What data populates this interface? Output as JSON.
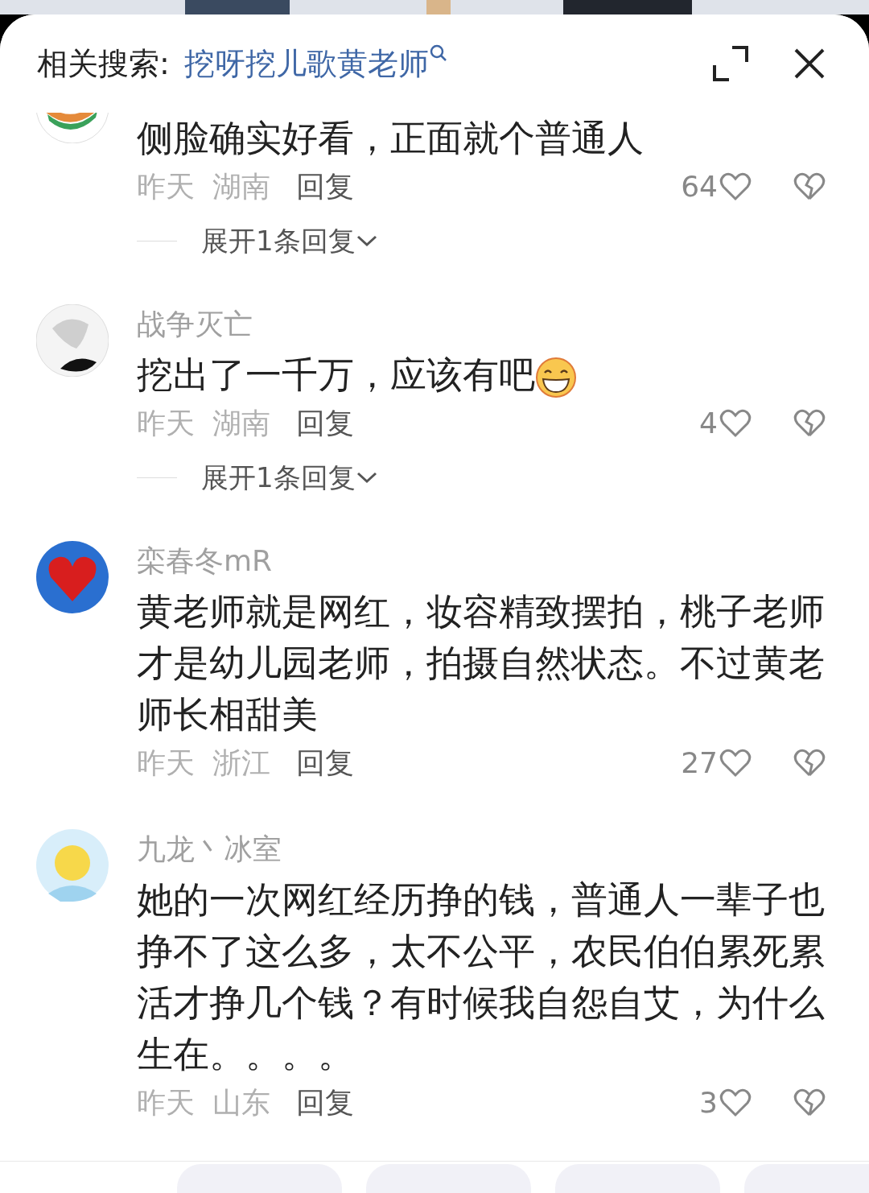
{
  "header": {
    "label": "相关搜索:",
    "query": "挖呀挖儿歌黄老师"
  },
  "comments": [
    {
      "text": "侧脸确实好看，正面就个普通人",
      "time": "昨天",
      "location": "湖南",
      "reply": "回复",
      "likes": "64",
      "expand": "展开1条回复"
    },
    {
      "name": "战争灭亡",
      "text": "挖出了一千万，应该有吧",
      "emoji": true,
      "time": "昨天",
      "location": "湖南",
      "reply": "回复",
      "likes": "4",
      "expand": "展开1条回复"
    },
    {
      "name": "栾春冬mR",
      "text": "黄老师就是网红，妆容精致摆拍，桃子老师才是幼儿园老师，拍摄自然状态。不过黄老师长相甜美",
      "time": "昨天",
      "location": "浙江",
      "reply": "回复",
      "likes": "27"
    },
    {
      "name": "九龙丶冰室",
      "text": "她的一次网红经历挣的钱，普通人一辈子也挣不了这么多，太不公平，农民伯伯累死累活才挣几个钱？有时候我自怨自艾，为什么生在。。。。",
      "time": "昨天",
      "location": "山东",
      "reply": "回复",
      "likes": "3"
    }
  ],
  "chips": [
    {
      "kind": "chip"
    },
    {
      "kind": "chip"
    },
    {
      "kind": "chip"
    },
    {
      "kind": "chip"
    }
  ]
}
